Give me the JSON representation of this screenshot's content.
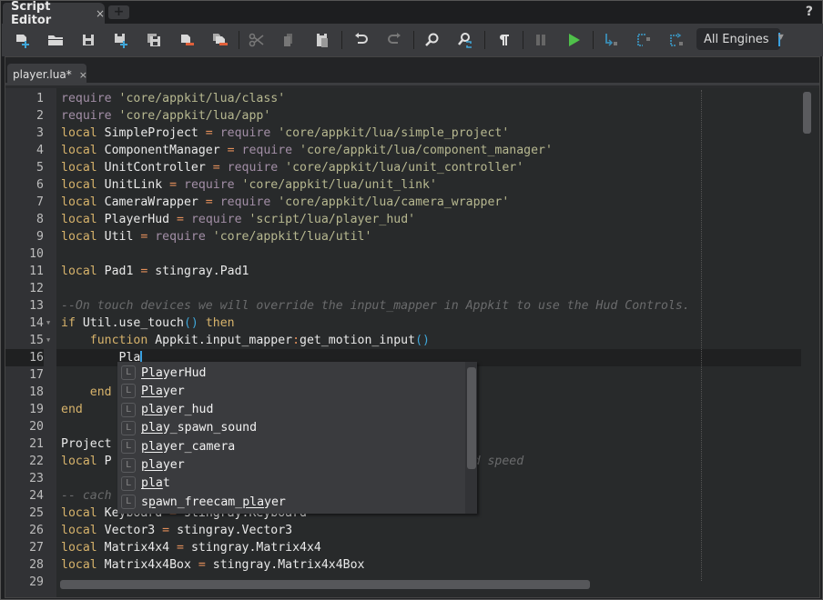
{
  "window": {
    "title_tab": "Script Editor",
    "close_glyph": "×",
    "new_tab_glyph": "+",
    "help_glyph": "?"
  },
  "toolbar": {
    "buttons": [
      {
        "name": "new-file",
        "icon": "new-file-icon"
      },
      {
        "name": "open-folder",
        "icon": "folder-icon"
      },
      {
        "name": "save",
        "icon": "save-icon"
      },
      {
        "name": "save-as",
        "icon": "save-as-icon"
      },
      {
        "name": "save-all",
        "icon": "save-all-icon"
      },
      {
        "name": "close-file",
        "icon": "close-file-icon"
      },
      {
        "name": "close-all",
        "icon": "close-all-icon"
      },
      {
        "name": "cut",
        "icon": "scissors-icon"
      },
      {
        "name": "copy",
        "icon": "copy-icon"
      },
      {
        "name": "paste",
        "icon": "paste-icon"
      },
      {
        "name": "undo",
        "icon": "undo-icon"
      },
      {
        "name": "redo",
        "icon": "redo-icon"
      },
      {
        "name": "find",
        "icon": "search-icon"
      },
      {
        "name": "find-replace",
        "icon": "search-replace-icon"
      },
      {
        "name": "show-whitespace",
        "icon": "pilcrow-icon"
      },
      {
        "name": "pause",
        "icon": "pause-icon"
      },
      {
        "name": "run",
        "icon": "play-icon"
      },
      {
        "name": "step-into",
        "icon": "step-into-icon"
      },
      {
        "name": "step-over",
        "icon": "step-over-icon"
      },
      {
        "name": "step-out",
        "icon": "step-out-icon"
      }
    ],
    "engine_select": "All Engines",
    "colors": {
      "accent_blue": "#3fa6d8",
      "run_green": "#4fc04a",
      "remove_red": "#e0603a"
    }
  },
  "document_tab": {
    "label": "player.lua*",
    "close_glyph": "×"
  },
  "editor": {
    "current_line": 16,
    "lines": [
      {
        "n": "1",
        "tokens": [
          {
            "c": "req",
            "t": "require "
          },
          {
            "c": "str",
            "t": "'core/appkit/lua/class'"
          }
        ]
      },
      {
        "n": "2",
        "tokens": [
          {
            "c": "req",
            "t": "require "
          },
          {
            "c": "str",
            "t": "'core/appkit/lua/app'"
          }
        ]
      },
      {
        "n": "3",
        "tokens": [
          {
            "c": "kw",
            "t": "local "
          },
          {
            "c": "id",
            "t": "SimpleProject "
          },
          {
            "c": "op",
            "t": "= "
          },
          {
            "c": "req",
            "t": "require "
          },
          {
            "c": "str",
            "t": "'core/appkit/lua/simple_project'"
          }
        ]
      },
      {
        "n": "4",
        "tokens": [
          {
            "c": "kw",
            "t": "local "
          },
          {
            "c": "id",
            "t": "ComponentManager "
          },
          {
            "c": "op",
            "t": "= "
          },
          {
            "c": "req",
            "t": "require "
          },
          {
            "c": "str",
            "t": "'core/appkit/lua/component_manager'"
          }
        ]
      },
      {
        "n": "5",
        "tokens": [
          {
            "c": "kw",
            "t": "local "
          },
          {
            "c": "id",
            "t": "UnitController "
          },
          {
            "c": "op",
            "t": "= "
          },
          {
            "c": "req",
            "t": "require "
          },
          {
            "c": "str",
            "t": "'core/appkit/lua/unit_controller'"
          }
        ]
      },
      {
        "n": "6",
        "tokens": [
          {
            "c": "kw",
            "t": "local "
          },
          {
            "c": "id",
            "t": "UnitLink "
          },
          {
            "c": "op",
            "t": "= "
          },
          {
            "c": "req",
            "t": "require "
          },
          {
            "c": "str",
            "t": "'core/appkit/lua/unit_link'"
          }
        ]
      },
      {
        "n": "7",
        "tokens": [
          {
            "c": "kw",
            "t": "local "
          },
          {
            "c": "id",
            "t": "CameraWrapper "
          },
          {
            "c": "op",
            "t": "= "
          },
          {
            "c": "req",
            "t": "require "
          },
          {
            "c": "str",
            "t": "'core/appkit/lua/camera_wrapper'"
          }
        ]
      },
      {
        "n": "8",
        "tokens": [
          {
            "c": "kw",
            "t": "local "
          },
          {
            "c": "id",
            "t": "PlayerHud "
          },
          {
            "c": "op",
            "t": "= "
          },
          {
            "c": "req",
            "t": "require "
          },
          {
            "c": "str",
            "t": "'script/lua/player_hud'"
          }
        ]
      },
      {
        "n": "9",
        "tokens": [
          {
            "c": "kw",
            "t": "local "
          },
          {
            "c": "id",
            "t": "Util "
          },
          {
            "c": "op",
            "t": "= "
          },
          {
            "c": "req",
            "t": "require "
          },
          {
            "c": "str",
            "t": "'core/appkit/lua/util'"
          }
        ]
      },
      {
        "n": "10",
        "tokens": []
      },
      {
        "n": "11",
        "tokens": [
          {
            "c": "kw",
            "t": "local "
          },
          {
            "c": "id",
            "t": "Pad1 "
          },
          {
            "c": "op",
            "t": "= "
          },
          {
            "c": "id",
            "t": "stingray.Pad1"
          }
        ]
      },
      {
        "n": "12",
        "tokens": []
      },
      {
        "n": "13",
        "tokens": [
          {
            "c": "cm",
            "t": "--On touch devices we will override the input_mapper in Appkit to use the Hud Controls."
          }
        ]
      },
      {
        "n": "14",
        "fold": true,
        "tokens": [
          {
            "c": "kw",
            "t": "if "
          },
          {
            "c": "id",
            "t": "Util.use_touch"
          },
          {
            "c": "par",
            "t": "()"
          },
          {
            "c": "kw",
            "t": " then"
          }
        ]
      },
      {
        "n": "15",
        "fold": true,
        "tokens": [
          {
            "c": "kw",
            "t": "    function "
          },
          {
            "c": "id",
            "t": "Appkit.input_mapper"
          },
          {
            "c": "op",
            "t": ":"
          },
          {
            "c": "id",
            "t": "get_motion_input"
          },
          {
            "c": "par",
            "t": "()"
          }
        ]
      },
      {
        "n": "16",
        "caret": true,
        "tokens": [
          {
            "c": "id",
            "t": "        Pla"
          }
        ]
      },
      {
        "n": "17",
        "tokens": []
      },
      {
        "n": "18",
        "tokens": [
          {
            "c": "kw",
            "t": "    end"
          }
        ]
      },
      {
        "n": "19",
        "tokens": [
          {
            "c": "kw",
            "t": "end"
          }
        ]
      },
      {
        "n": "20",
        "tokens": []
      },
      {
        "n": "21",
        "tokens": [
          {
            "c": "id",
            "t": "Project"
          }
        ]
      },
      {
        "n": "22",
        "tokens": [
          {
            "c": "kw",
            "t": "local "
          },
          {
            "c": "id",
            "t": "P"
          },
          {
            "c": "id",
            "t": "                                         "
          },
          {
            "c": "cm",
            "t": "bility and speed"
          }
        ]
      },
      {
        "n": "23",
        "tokens": []
      },
      {
        "n": "24",
        "tokens": [
          {
            "c": "cm",
            "t": "-- cach"
          }
        ]
      },
      {
        "n": "25",
        "tokens": [
          {
            "c": "kw",
            "t": "local "
          },
          {
            "c": "id",
            "t": "Keyboard "
          },
          {
            "c": "op",
            "t": "= "
          },
          {
            "c": "id",
            "t": "stingray.Keyboard"
          }
        ]
      },
      {
        "n": "26",
        "tokens": [
          {
            "c": "kw",
            "t": "local "
          },
          {
            "c": "id",
            "t": "Vector3 "
          },
          {
            "c": "op",
            "t": "= "
          },
          {
            "c": "id",
            "t": "stingray.Vector3"
          }
        ]
      },
      {
        "n": "27",
        "tokens": [
          {
            "c": "kw",
            "t": "local "
          },
          {
            "c": "id",
            "t": "Matrix4x4 "
          },
          {
            "c": "op",
            "t": "= "
          },
          {
            "c": "id",
            "t": "stingray.Matrix4x4"
          }
        ]
      },
      {
        "n": "28",
        "tokens": [
          {
            "c": "kw",
            "t": "local "
          },
          {
            "c": "id",
            "t": "Matrix4x4Box "
          },
          {
            "c": "op",
            "t": "= "
          },
          {
            "c": "id",
            "t": "stingray.Matrix4x4Box"
          }
        ]
      },
      {
        "n": "29",
        "tokens": []
      }
    ]
  },
  "autocomplete": {
    "query": "Pla",
    "badge": "L",
    "items": [
      {
        "pre": "",
        "match": "Pla",
        "post": "yerHud"
      },
      {
        "pre": "",
        "match": "Pla",
        "post": "yer"
      },
      {
        "pre": "",
        "match": "pla",
        "post": "yer_hud"
      },
      {
        "pre": "",
        "match": "pla",
        "post": "y_spawn_sound"
      },
      {
        "pre": "",
        "match": "pla",
        "post": "yer_camera"
      },
      {
        "pre": "",
        "match": "pla",
        "post": "yer"
      },
      {
        "pre": "",
        "match": "pla",
        "post": "t"
      },
      {
        "pre": "s",
        "match": "p",
        "post": "awn_freecam_",
        "match2": "pla",
        "post2": "yer"
      }
    ]
  }
}
